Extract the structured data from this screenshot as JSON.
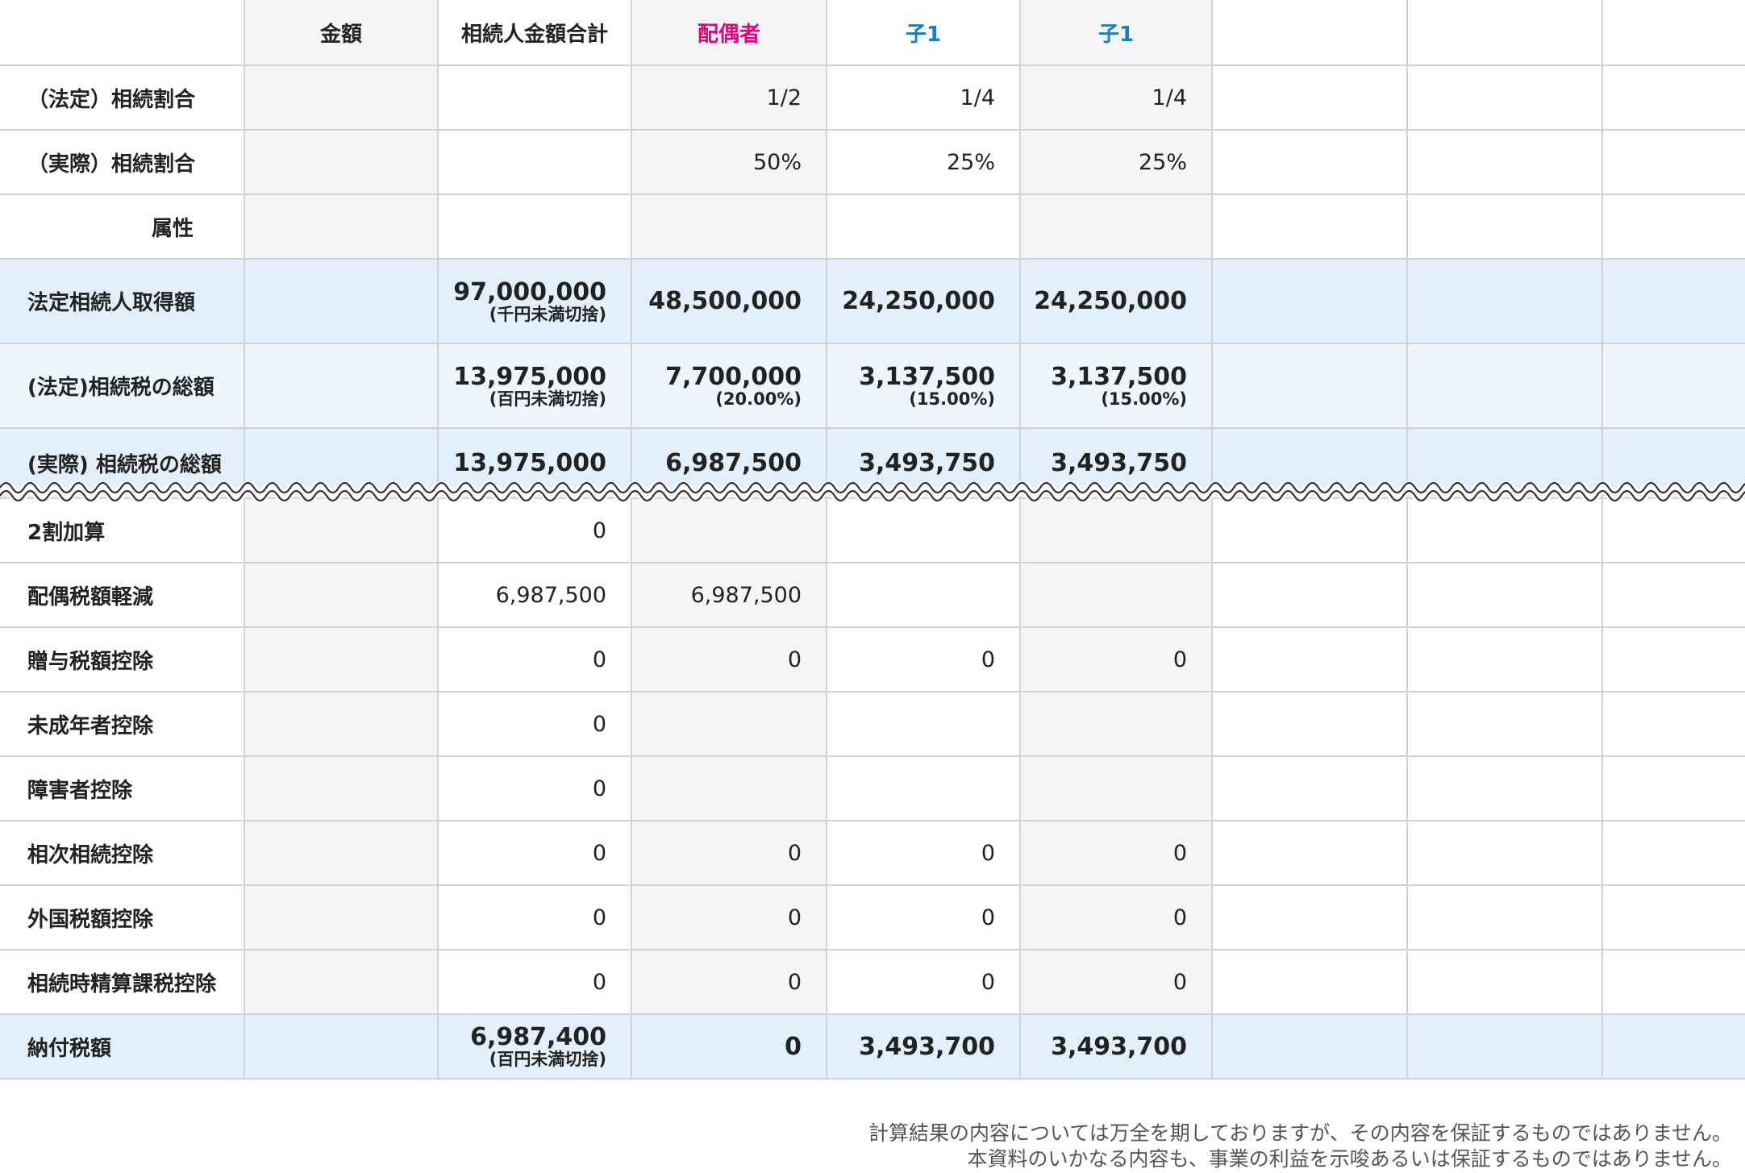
{
  "header": {
    "amount": "金額",
    "total": "相続人金額合計",
    "heirs": [
      "配偶者",
      "子1",
      "子1"
    ]
  },
  "colors": {
    "spouse": "#e6007e",
    "child": "#1a7fc1",
    "highlight_row": "#e3effb"
  },
  "ratio_rows": [
    {
      "label": "（法定）相続割合",
      "values": [
        "1/2",
        "1/4",
        "1/4"
      ]
    },
    {
      "label": "（実際）相続割合",
      "values": [
        "50%",
        "25%",
        "25%"
      ]
    },
    {
      "label": "属性",
      "values": [
        "",
        "",
        ""
      ]
    }
  ],
  "highlight_rows": [
    {
      "label": "法定相続人取得額",
      "total": "97,000,000",
      "total_note": "(千円未満切捨)",
      "values": [
        "48,500,000",
        "24,250,000",
        "24,250,000"
      ],
      "notes": [
        "",
        "",
        ""
      ]
    },
    {
      "label": "(法定)相続税の総額",
      "total": "13,975,000",
      "total_note": "(百円未満切捨)",
      "values": [
        "7,700,000",
        "3,137,500",
        "3,137,500"
      ],
      "notes": [
        "(20.00%)",
        "(15.00%)",
        "(15.00%)"
      ]
    },
    {
      "label": "(実際) 相続税の総額",
      "total": "13,975,000",
      "total_note": "",
      "values": [
        "6,987,500",
        "3,493,750",
        "3,493,750"
      ],
      "notes": [
        "",
        "",
        ""
      ]
    }
  ],
  "deduction_rows": [
    {
      "label": "2割加算",
      "total": "0",
      "values": [
        "",
        "",
        ""
      ]
    },
    {
      "label": "配偶税額軽減",
      "total": "6,987,500",
      "values": [
        "6,987,500",
        "",
        ""
      ]
    },
    {
      "label": "贈与税額控除",
      "total": "0",
      "values": [
        "0",
        "0",
        "0"
      ]
    },
    {
      "label": "未成年者控除",
      "total": "0",
      "values": [
        "",
        "",
        ""
      ]
    },
    {
      "label": "障害者控除",
      "total": "0",
      "values": [
        "",
        "",
        ""
      ]
    },
    {
      "label": "相次相続控除",
      "total": "0",
      "values": [
        "0",
        "0",
        "0"
      ]
    },
    {
      "label": "外国税額控除",
      "total": "0",
      "values": [
        "0",
        "0",
        "0"
      ]
    },
    {
      "label": "相続時精算課税控除",
      "total": "0",
      "values": [
        "0",
        "0",
        "0"
      ]
    }
  ],
  "payment_row": {
    "label": "納付税額",
    "total": "6,987,400",
    "total_note": "(百円未満切捨)",
    "values": [
      "0",
      "3,493,700",
      "3,493,700"
    ]
  },
  "disclaimer": {
    "line1": "計算結果の内容については万全を期しておりますが、その内容を保証するものではありません。",
    "line2": "本資料のいかなる内容も、事業の利益を示唆あるいは保証するものではありません。"
  }
}
